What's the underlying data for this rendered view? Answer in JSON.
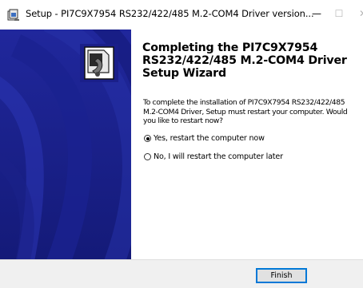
{
  "window": {
    "title": "Setup - PI7C9X7954 RS232/422/485 M.2-COM4 Driver version...",
    "minimize_glyph": "—",
    "maximize_glyph": "☐",
    "close_glyph": "✕"
  },
  "wizard": {
    "heading": "Completing the PI7C9X7954\nRS232/422/485 M.2-COM4 Driver\nSetup Wizard",
    "message": "To complete the installation of PI7C9X7954 RS232/422/485 M.2-COM4 Driver, Setup must restart your computer. Would you like to restart now?",
    "options": [
      {
        "label": "Yes, restart the computer now",
        "selected": true
      },
      {
        "label": "No, I will restart the computer later",
        "selected": false
      }
    ]
  },
  "buttons": {
    "finish_label": "Finish"
  },
  "colors": {
    "side_panel": "#1d2294",
    "accent": "#0078d7"
  }
}
